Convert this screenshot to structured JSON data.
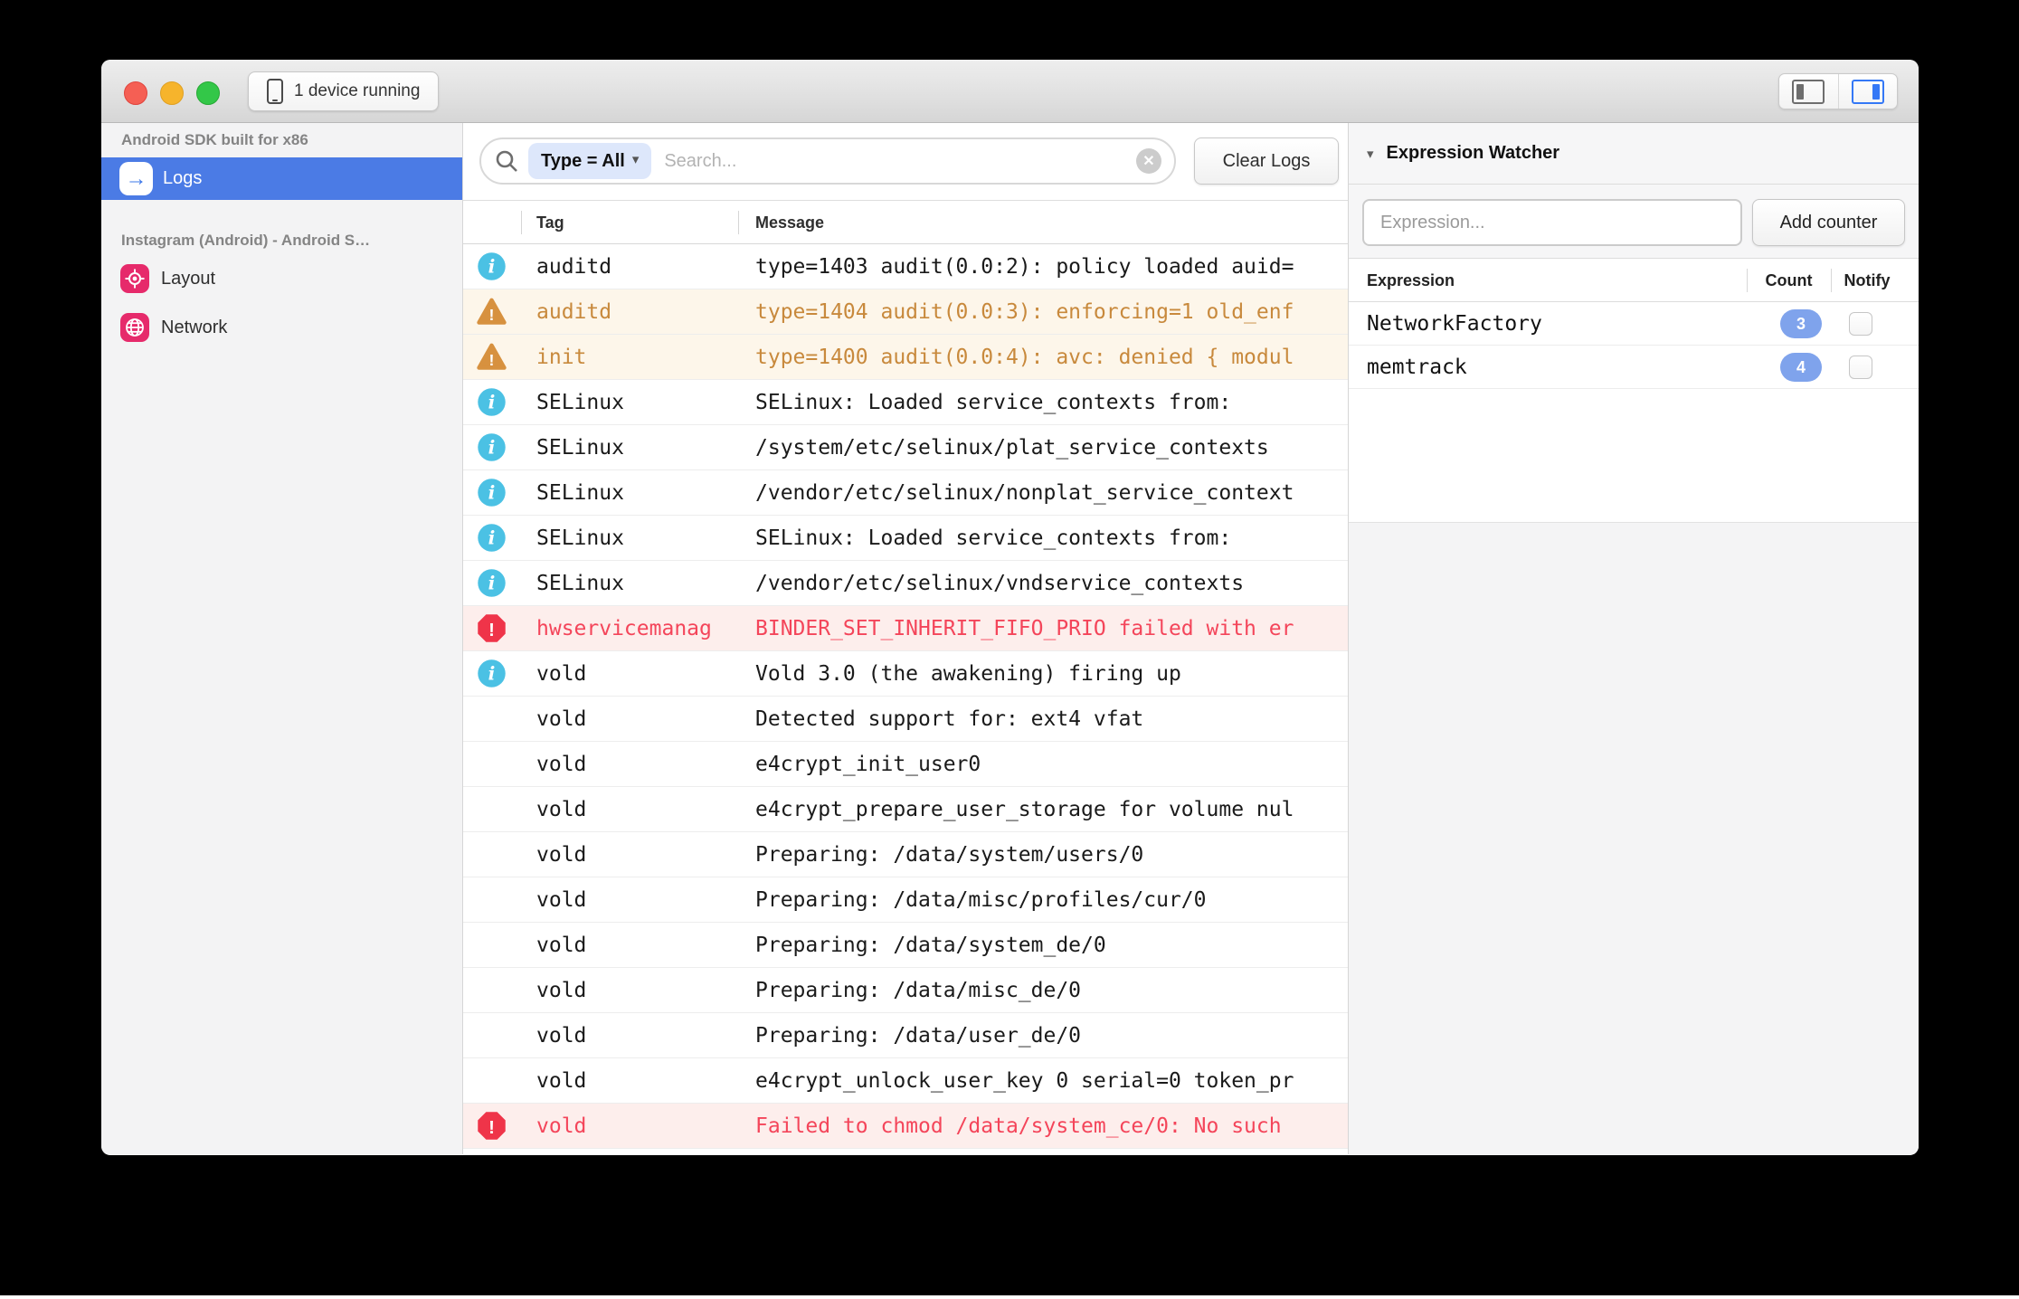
{
  "window": {
    "device_button_label": "1 device running"
  },
  "sidebar": {
    "device_section": "Android SDK built for x86",
    "logs_label": "Logs",
    "app_section": "Instagram (Android) - Android S…",
    "plugins": [
      {
        "label": "Layout",
        "icon": "target-icon"
      },
      {
        "label": "Network",
        "icon": "globe-icon"
      }
    ]
  },
  "toolbar": {
    "filter_chip": "Type = All",
    "search_placeholder": "Search...",
    "clear_logs_label": "Clear Logs"
  },
  "log_table": {
    "columns": [
      "Tag",
      "Message"
    ],
    "rows": [
      {
        "level": "info",
        "tag": "auditd",
        "message": "type=1403 audit(0.0:2): policy loaded auid="
      },
      {
        "level": "warning",
        "tag": "auditd",
        "message": "type=1404 audit(0.0:3): enforcing=1 old_enf"
      },
      {
        "level": "warning",
        "tag": "init",
        "message": "type=1400 audit(0.0:4): avc: denied { modul"
      },
      {
        "level": "info",
        "tag": "SELinux",
        "message": "SELinux: Loaded service_contexts from:"
      },
      {
        "level": "info",
        "tag": "SELinux",
        "message": "/system/etc/selinux/plat_service_contexts"
      },
      {
        "level": "info",
        "tag": "SELinux",
        "message": "/vendor/etc/selinux/nonplat_service_context"
      },
      {
        "level": "info",
        "tag": "SELinux",
        "message": "SELinux: Loaded service_contexts from:"
      },
      {
        "level": "info",
        "tag": "SELinux",
        "message": "/vendor/etc/selinux/vndservice_contexts"
      },
      {
        "level": "error",
        "tag": "hwservicemanag",
        "message": "BINDER_SET_INHERIT_FIFO_PRIO failed with er"
      },
      {
        "level": "info",
        "tag": "vold",
        "message": "Vold 3.0 (the awakening) firing up"
      },
      {
        "level": "none",
        "tag": "vold",
        "message": "Detected support for: ext4 vfat"
      },
      {
        "level": "none",
        "tag": "vold",
        "message": "e4crypt_init_user0"
      },
      {
        "level": "none",
        "tag": "vold",
        "message": "e4crypt_prepare_user_storage for volume nul"
      },
      {
        "level": "none",
        "tag": "vold",
        "message": "Preparing: /data/system/users/0"
      },
      {
        "level": "none",
        "tag": "vold",
        "message": "Preparing: /data/misc/profiles/cur/0"
      },
      {
        "level": "none",
        "tag": "vold",
        "message": "Preparing: /data/system_de/0"
      },
      {
        "level": "none",
        "tag": "vold",
        "message": "Preparing: /data/misc_de/0"
      },
      {
        "level": "none",
        "tag": "vold",
        "message": "Preparing: /data/user_de/0"
      },
      {
        "level": "none",
        "tag": "vold",
        "message": "e4crypt_unlock_user_key 0 serial=0 token_pr"
      },
      {
        "level": "error",
        "tag": "vold",
        "message": "Failed to chmod /data/system_ce/0: No such"
      }
    ]
  },
  "watcher": {
    "title": "Expression Watcher",
    "input_placeholder": "Expression...",
    "add_button_label": "Add counter",
    "columns": [
      "Expression",
      "Count",
      "Notify"
    ],
    "rows": [
      {
        "expression": "NetworkFactory",
        "count": "3",
        "notify": false
      },
      {
        "expression": "memtrack",
        "count": "4",
        "notify": false
      }
    ]
  },
  "colors": {
    "selection_blue": "#4b7be5",
    "info_icon": "#4bc1e4",
    "warning_icon": "#d7913f",
    "warning_text": "#c8893c",
    "warning_row_bg": "#fdf6ea",
    "error_icon": "#ef3449",
    "error_text": "#f4455a",
    "error_row_bg": "#fdeeec",
    "plugin_icon_pink": "#e62a6b",
    "count_pill_blue": "#7fa3ec",
    "filter_chip_bg": "#dde7fb"
  }
}
